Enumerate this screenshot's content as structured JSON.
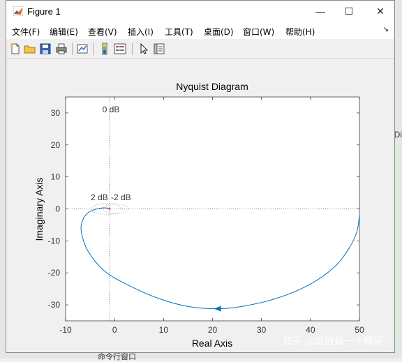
{
  "window": {
    "title": "Figure 1",
    "minimize": "—",
    "maximize": "☐",
    "close": "✕"
  },
  "menu": [
    {
      "label": "文件(F)"
    },
    {
      "label": "编辑(E)"
    },
    {
      "label": "查看(V)"
    },
    {
      "label": "插入(I)"
    },
    {
      "label": "工具(T)"
    },
    {
      "label": "桌面(D)"
    },
    {
      "label": "窗口(W)"
    },
    {
      "label": "帮助(H)"
    }
  ],
  "toolbar": [
    "new-figure-icon",
    "open-folder-icon",
    "save-icon",
    "print-icon",
    "link-plot-icon",
    "colorbar-icon",
    "legend-icon",
    "pointer-icon",
    "property-editor-icon"
  ],
  "background": {
    "right_tag": "Di",
    "command_text": "命令行窗口"
  },
  "watermark": "知乎 @绽放每一个瞬间",
  "chart_data": {
    "type": "line",
    "title": "Nyquist Diagram",
    "xlabel": "Real Axis",
    "ylabel": "Imaginary Axis",
    "xlim": [
      -10,
      50
    ],
    "ylim": [
      -35,
      35
    ],
    "xticks": [
      "-10",
      "0",
      "10",
      "20",
      "30",
      "40",
      "50"
    ],
    "yticks": [
      "30",
      "20",
      "10",
      "0",
      "-10",
      "-20",
      "-30"
    ],
    "grid_labels": {
      "zero_db": "0 dB",
      "two_db": "2 dB",
      "minus_two_db": "-2 dB"
    },
    "critical_point": {
      "x": -1,
      "y": 0
    },
    "series": [
      {
        "color": "#0072bd",
        "x": [
          50,
          49.5,
          48,
          45,
          40,
          33,
          26,
          21,
          15,
          9,
          3,
          -2,
          -5.5,
          -6.8,
          -6.5,
          -5.5,
          -4,
          -2.5,
          -1
        ],
        "y": [
          -2,
          -7,
          -12,
          -18,
          -23.5,
          -28,
          -30.5,
          -31.2,
          -30.5,
          -28,
          -24,
          -19.5,
          -13,
          -7,
          -3.5,
          -1.3,
          -0.2,
          0.3,
          0.2
        ]
      }
    ],
    "arrow": {
      "x": 21,
      "y": -31.2
    }
  }
}
